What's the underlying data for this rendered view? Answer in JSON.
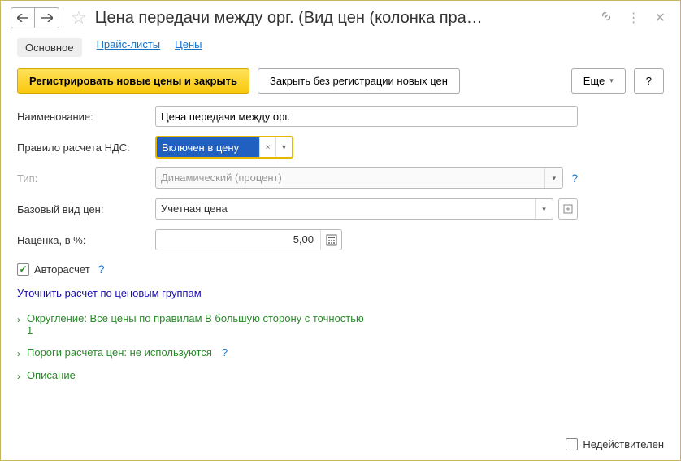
{
  "header": {
    "title": "Цена передачи между орг. (Вид цен (колонка пра…"
  },
  "tabs": [
    {
      "label": "Основное",
      "active": true
    },
    {
      "label": "Прайс-листы",
      "active": false
    },
    {
      "label": "Цены",
      "active": false
    }
  ],
  "toolbar": {
    "primary": "Регистрировать новые цены и закрыть",
    "secondary": "Закрыть без регистрации новых цен",
    "more": "Еще",
    "help": "?"
  },
  "form": {
    "name_label": "Наименование:",
    "name_value": "Цена передачи между орг.",
    "vat_label": "Правило расчета НДС:",
    "vat_value": "Включен в цену",
    "type_label": "Тип:",
    "type_value": "Динамический (процент)",
    "base_label": "Базовый вид цен:",
    "base_value": "Учетная цена",
    "markup_label": "Наценка, в %:",
    "markup_value": "5,00",
    "autocalc_label": "Авторасчет",
    "refine_link": "Уточнить расчет по ценовым группам",
    "sections": {
      "rounding_line1": "Округление: Все цены по правилам В большую сторону с точностью",
      "rounding_line2": "1",
      "thresholds": "Пороги расчета цен: не используются",
      "description": "Описание"
    }
  },
  "footer": {
    "inactive_label": "Недействителен"
  }
}
